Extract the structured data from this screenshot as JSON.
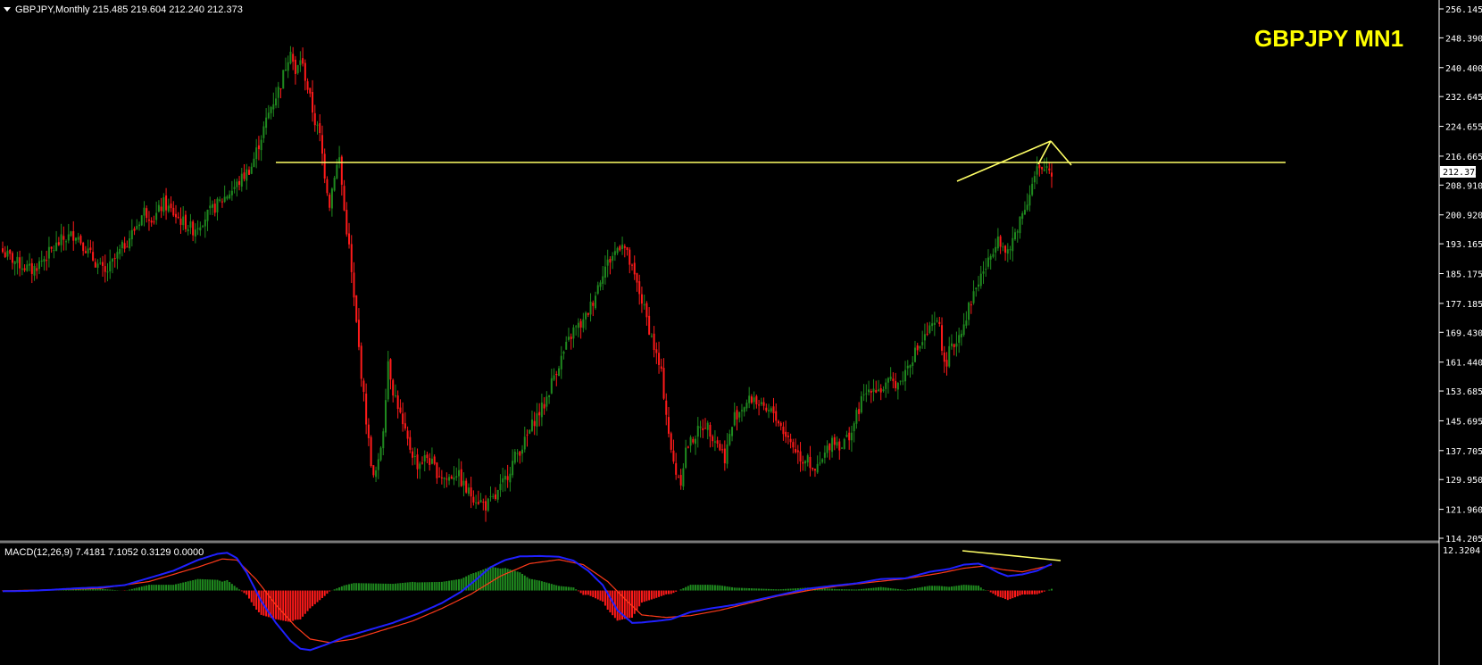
{
  "header": {
    "chart_info": "GBPJPY,Monthly  215.485 219.604 212.240 212.373",
    "symbol_title": "GBPJPY  MN1"
  },
  "price_axis": {
    "ticks": [
      "256.145",
      "248.390",
      "240.400",
      "232.645",
      "224.655",
      "216.665",
      "208.910",
      "200.920",
      "193.165",
      "185.175",
      "177.185",
      "169.430",
      "161.440",
      "153.685",
      "145.695",
      "137.705",
      "129.950",
      "121.960",
      "114.205"
    ],
    "current_price_label": "212.373"
  },
  "indicator": {
    "label": "MACD(12,26,9) 7.4181 7.1052 0.3129 0.0000",
    "max_label": "12.3204"
  },
  "colors": {
    "bull": "#1f8a1f",
    "bear": "#ff1a1a",
    "resistance": "#ffff66",
    "macd_line": "#2020ff",
    "signal_line": "#ff3a1a",
    "background": "#000000",
    "axis_text": "#ffffff"
  },
  "chart_data": {
    "type": "candlestick",
    "symbol": "GBPJPY",
    "timeframe": "Monthly",
    "ohlc_last": {
      "open": 215.485,
      "high": 219.604,
      "low": 212.24,
      "close": 212.373
    },
    "ylim": [
      114.205,
      256.145
    ],
    "close_path": [
      [
        0,
        191
      ],
      [
        6,
        188
      ],
      [
        12,
        186
      ],
      [
        18,
        190
      ],
      [
        24,
        194
      ],
      [
        30,
        196
      ],
      [
        36,
        190
      ],
      [
        42,
        185
      ],
      [
        48,
        191
      ],
      [
        54,
        197
      ],
      [
        58,
        202
      ],
      [
        62,
        200
      ],
      [
        66,
        204
      ],
      [
        72,
        200
      ],
      [
        78,
        197
      ],
      [
        84,
        201
      ],
      [
        90,
        205
      ],
      [
        96,
        209
      ],
      [
        102,
        214
      ],
      [
        106,
        222
      ],
      [
        110,
        230
      ],
      [
        114,
        236
      ],
      [
        118,
        246
      ],
      [
        120,
        238
      ],
      [
        122,
        243
      ],
      [
        124,
        238
      ],
      [
        126,
        232
      ],
      [
        128,
        226
      ],
      [
        130,
        222
      ],
      [
        132,
        212
      ],
      [
        134,
        204
      ],
      [
        136,
        212
      ],
      [
        138,
        216
      ],
      [
        140,
        202
      ],
      [
        142,
        192
      ],
      [
        144,
        178
      ],
      [
        146,
        165
      ],
      [
        148,
        152
      ],
      [
        150,
        140
      ],
      [
        152,
        130
      ],
      [
        154,
        134
      ],
      [
        156,
        144
      ],
      [
        158,
        162
      ],
      [
        160,
        154
      ],
      [
        162,
        150
      ],
      [
        164,
        144
      ],
      [
        166,
        140
      ],
      [
        170,
        134
      ],
      [
        174,
        136
      ],
      [
        178,
        132
      ],
      [
        182,
        130
      ],
      [
        186,
        132
      ],
      [
        190,
        127
      ],
      [
        194,
        125
      ],
      [
        198,
        123
      ],
      [
        202,
        125
      ],
      [
        206,
        130
      ],
      [
        210,
        136
      ],
      [
        214,
        140
      ],
      [
        218,
        146
      ],
      [
        222,
        150
      ],
      [
        226,
        158
      ],
      [
        230,
        164
      ],
      [
        234,
        170
      ],
      [
        238,
        172
      ],
      [
        242,
        178
      ],
      [
        246,
        186
      ],
      [
        250,
        190
      ],
      [
        254,
        194
      ],
      [
        256,
        190
      ],
      [
        258,
        186
      ],
      [
        262,
        178
      ],
      [
        266,
        168
      ],
      [
        270,
        158
      ],
      [
        272,
        148
      ],
      [
        274,
        137
      ],
      [
        276,
        132
      ],
      [
        278,
        130
      ],
      [
        280,
        138
      ],
      [
        284,
        142
      ],
      [
        288,
        145
      ],
      [
        292,
        141
      ],
      [
        296,
        136
      ],
      [
        300,
        147
      ],
      [
        304,
        150
      ],
      [
        308,
        152
      ],
      [
        312,
        148
      ],
      [
        316,
        148
      ],
      [
        320,
        143
      ],
      [
        324,
        139
      ],
      [
        328,
        135
      ],
      [
        330,
        137
      ],
      [
        332,
        131
      ],
      [
        336,
        135
      ],
      [
        340,
        141
      ],
      [
        344,
        139
      ],
      [
        348,
        143
      ],
      [
        352,
        151
      ],
      [
        356,
        155
      ],
      [
        360,
        154
      ],
      [
        364,
        156
      ],
      [
        368,
        156
      ],
      [
        372,
        162
      ],
      [
        376,
        166
      ],
      [
        380,
        170
      ],
      [
        384,
        172
      ],
      [
        386,
        160
      ],
      [
        388,
        164
      ],
      [
        390,
        166
      ],
      [
        394,
        172
      ],
      [
        398,
        180
      ],
      [
        402,
        186
      ],
      [
        404,
        188
      ],
      [
        406,
        192
      ],
      [
        408,
        196
      ],
      [
        410,
        192
      ],
      [
        412,
        190
      ],
      [
        416,
        198
      ],
      [
        420,
        205
      ],
      [
        422,
        209
      ],
      [
        424,
        213
      ],
      [
        426,
        212
      ],
      [
        428,
        214
      ],
      [
        430,
        212
      ]
    ],
    "resistance_level": 215.485,
    "macd_path": [
      [
        0,
        -0.2
      ],
      [
        10,
        -0.1
      ],
      [
        20,
        0.2
      ],
      [
        30,
        0.6
      ],
      [
        40,
        0.9
      ],
      [
        50,
        1.5
      ],
      [
        60,
        3.5
      ],
      [
        70,
        5.5
      ],
      [
        80,
        8.5
      ],
      [
        88,
        10.2
      ],
      [
        92,
        10.5
      ],
      [
        96,
        9
      ],
      [
        100,
        5
      ],
      [
        106,
        -3
      ],
      [
        112,
        -9
      ],
      [
        118,
        -14
      ],
      [
        122,
        -16.2
      ],
      [
        126,
        -16.6
      ],
      [
        132,
        -15.2
      ],
      [
        140,
        -13
      ],
      [
        150,
        -11
      ],
      [
        160,
        -9
      ],
      [
        170,
        -6.5
      ],
      [
        180,
        -3.5
      ],
      [
        188,
        -0.3
      ],
      [
        194,
        3
      ],
      [
        200,
        6.5
      ],
      [
        206,
        8.5
      ],
      [
        212,
        9.5
      ],
      [
        220,
        9.6
      ],
      [
        228,
        9.4
      ],
      [
        234,
        8.3
      ],
      [
        240,
        5.5
      ],
      [
        246,
        1.5
      ],
      [
        252,
        -5.5
      ],
      [
        258,
        -9
      ],
      [
        262,
        -8.9
      ],
      [
        268,
        -8.5
      ],
      [
        274,
        -8
      ],
      [
        282,
        -6
      ],
      [
        290,
        -5
      ],
      [
        300,
        -4
      ],
      [
        310,
        -2.5
      ],
      [
        320,
        -1
      ],
      [
        330,
        0.5
      ],
      [
        340,
        1.3
      ],
      [
        350,
        2
      ],
      [
        360,
        3.2
      ],
      [
        370,
        3.4
      ],
      [
        380,
        5.2
      ],
      [
        388,
        6
      ],
      [
        394,
        7.2
      ],
      [
        400,
        7.5
      ],
      [
        404,
        6.5
      ],
      [
        408,
        5
      ],
      [
        412,
        4
      ],
      [
        418,
        4.5
      ],
      [
        424,
        5.5
      ],
      [
        430,
        7.4
      ]
    ],
    "signal_path": [
      [
        0,
        -0.1
      ],
      [
        20,
        0.2
      ],
      [
        40,
        0.6
      ],
      [
        60,
        2.5
      ],
      [
        80,
        6.5
      ],
      [
        90,
        8.8
      ],
      [
        96,
        8.5
      ],
      [
        104,
        3
      ],
      [
        112,
        -4
      ],
      [
        120,
        -10
      ],
      [
        126,
        -13.5
      ],
      [
        134,
        -14.5
      ],
      [
        144,
        -13.5
      ],
      [
        156,
        -11
      ],
      [
        168,
        -8.5
      ],
      [
        180,
        -5
      ],
      [
        192,
        -1
      ],
      [
        204,
        4
      ],
      [
        216,
        7.5
      ],
      [
        228,
        8.6
      ],
      [
        238,
        7.2
      ],
      [
        248,
        2.5
      ],
      [
        256,
        -3
      ],
      [
        262,
        -6.8
      ],
      [
        272,
        -7.5
      ],
      [
        282,
        -7
      ],
      [
        294,
        -5.5
      ],
      [
        306,
        -3.5
      ],
      [
        318,
        -1.5
      ],
      [
        330,
        0
      ],
      [
        342,
        1.2
      ],
      [
        356,
        2.3
      ],
      [
        370,
        3.3
      ],
      [
        384,
        4.8
      ],
      [
        394,
        6.2
      ],
      [
        402,
        6.8
      ],
      [
        410,
        5.8
      ],
      [
        418,
        5.2
      ],
      [
        430,
        7.1
      ]
    ],
    "macd_ylim": [
      -20,
      12.3204
    ]
  }
}
